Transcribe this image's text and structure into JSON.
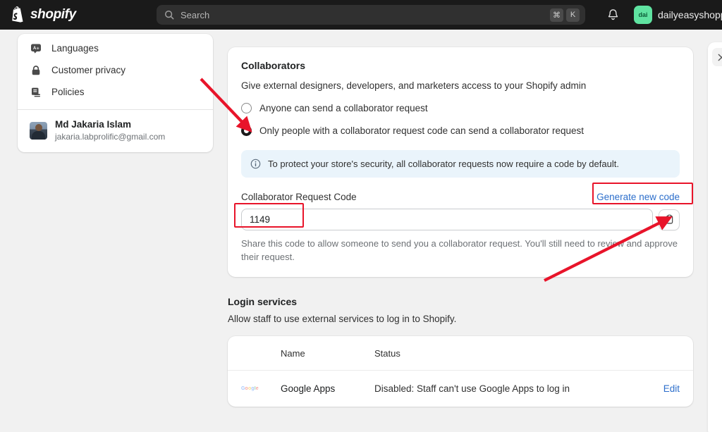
{
  "topbar": {
    "brand": "shopify",
    "search_placeholder": "Search",
    "shortcut_keys": [
      "⌘",
      "K"
    ],
    "notifications_label": "Notifications",
    "account_initials": "dai",
    "account_name": "dailyeasyshoppin"
  },
  "sidebar": {
    "items": [
      {
        "label": "Languages",
        "icon": "languages-icon"
      },
      {
        "label": "Customer privacy",
        "icon": "lock-icon"
      },
      {
        "label": "Policies",
        "icon": "policies-icon"
      }
    ],
    "profile": {
      "name": "Md Jakaria Islam",
      "email": "jakaria.labprolific@gmail.com"
    }
  },
  "collaborators": {
    "title": "Collaborators",
    "subtitle": "Give external designers, developers, and marketers access to your Shopify admin",
    "options": [
      {
        "label": "Anyone can send a collaborator request",
        "selected": false
      },
      {
        "label": "Only people with a collaborator request code can send a collaborator request",
        "selected": true
      }
    ],
    "banner": "To protect your store's security, all collaborator requests now require a code by default.",
    "code_label": "Collaborator Request Code",
    "generate_link": "Generate new code",
    "code_value": "1149",
    "copy_label": "Copy code",
    "help_text": "Share this code to allow someone to send you a collaborator request. You'll still need to review and approve their request."
  },
  "login_services": {
    "title": "Login services",
    "subtitle": "Allow staff to use external services to log in to Shopify.",
    "columns": [
      "Name",
      "Status"
    ],
    "rows": [
      {
        "icon": "google-logo",
        "name": "Google Apps",
        "status": "Disabled: Staff can't use Google Apps to log in",
        "action": "Edit"
      }
    ]
  },
  "right_panel": {
    "close_label": "×"
  },
  "annotation_color": "#e8142a"
}
